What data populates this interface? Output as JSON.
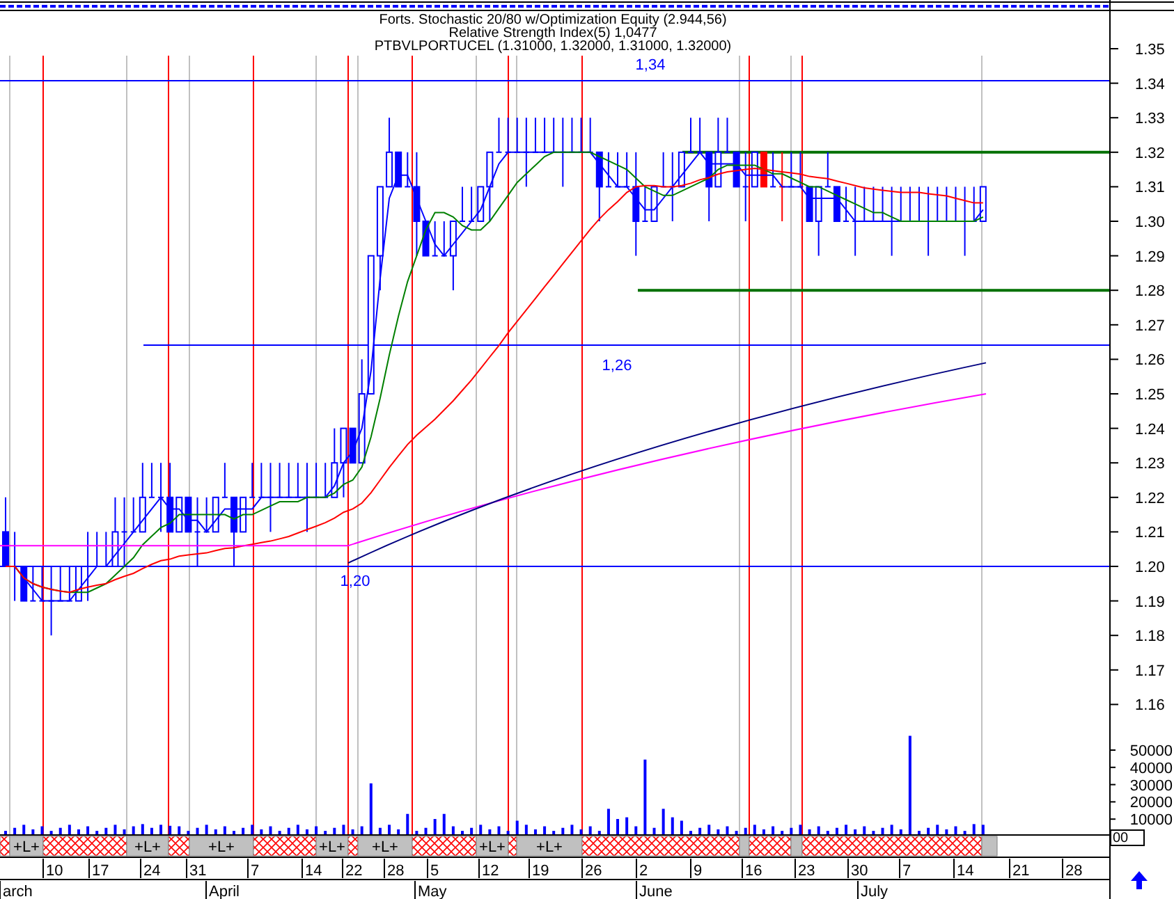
{
  "header": {
    "lines": [
      "Forts. Stochastic 20/80 w/Optimization Equity (2.944,56)",
      "Relative Strength Index(5) 1,0477",
      "PTBVLPORTUCEL (1.31000, 1.32000, 1.31000, 1.32000)"
    ]
  },
  "annotations": [
    {
      "text": "1,34"
    },
    {
      "text": "1,26"
    },
    {
      "text": "1,20"
    }
  ],
  "price_axis": {
    "labels": [
      "1.35",
      "1.34",
      "1.33",
      "1.32",
      "1.31",
      "1.30",
      "1.29",
      "1.28",
      "1.27",
      "1.26",
      "1.25",
      "1.24",
      "1.23",
      "1.22",
      "1.21",
      "1.20",
      "1.19",
      "1.18",
      "1.17",
      "1.16"
    ]
  },
  "volume_axis": {
    "labels": [
      "50000",
      "40000",
      "30000",
      "20000",
      "10000"
    ],
    "corner": "00"
  },
  "session_bar": [
    {
      "kind": "hatched"
    },
    {
      "kind": "signal",
      "label": "+L+"
    },
    {
      "kind": "hatched"
    },
    {
      "kind": "signal",
      "label": "+L+"
    },
    {
      "kind": "hatched"
    },
    {
      "kind": "signal",
      "label": "+L+"
    },
    {
      "kind": "hatched"
    },
    {
      "kind": "signal",
      "label": "+L+"
    },
    {
      "kind": "hatched"
    },
    {
      "kind": "signal",
      "label": "+L+"
    },
    {
      "kind": "hatched"
    },
    {
      "kind": "signal",
      "label": "+L+"
    },
    {
      "kind": "hatched"
    },
    {
      "kind": "signal",
      "label": "+L+"
    },
    {
      "kind": "hatched"
    },
    {
      "kind": "signal"
    },
    {
      "kind": "hatched"
    },
    {
      "kind": "signal"
    },
    {
      "kind": "hatched"
    },
    {
      "kind": "signal"
    }
  ],
  "date_axis": {
    "days": [
      "10",
      "17",
      "24",
      "31",
      "7",
      "14",
      "22",
      "28",
      "5",
      "12",
      "19",
      "26",
      "2",
      "9",
      "16",
      "23",
      "30",
      "7",
      "14",
      "21",
      "28"
    ],
    "months": [
      "arch",
      "April",
      "May",
      "June",
      "July"
    ]
  }
}
